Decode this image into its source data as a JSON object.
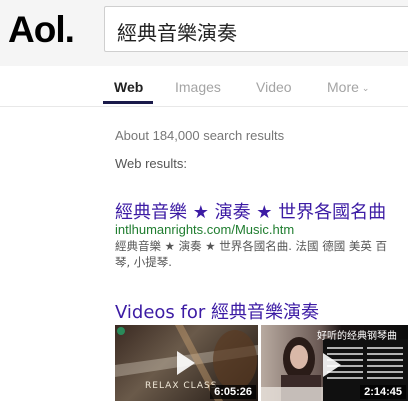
{
  "header": {
    "logo": "Aol.",
    "search": {
      "value": "經典音樂演奏"
    }
  },
  "tabs": [
    {
      "label": "Web",
      "active": true
    },
    {
      "label": "Images",
      "active": false
    },
    {
      "label": "Video",
      "active": false
    },
    {
      "label": "More",
      "active": false
    }
  ],
  "results": {
    "count_text": "About 184,000 search results",
    "section_label": "Web results:",
    "items": [
      {
        "title": "經典音樂 ★ 演奏 ★ 世界各國名曲",
        "url": "intlhumanrights.com/Music.htm",
        "snippet": "經典音樂 ★ 演奏 ★ 世界各國名曲. 法國 德國 美英 百 琴, 小提琴."
      }
    ],
    "videos_title": "Videos for 經典音樂演奏",
    "videos": [
      {
        "duration": "6:05:26",
        "overlay_text": "RELAX CLASS"
      },
      {
        "duration": "2:14:45",
        "overlay_text": "好听的经典钢琴曲"
      }
    ]
  },
  "colors": {
    "link": "#3c1ba4",
    "url": "#1f7d2f",
    "active_tab_underline": "#1a1a4a"
  }
}
